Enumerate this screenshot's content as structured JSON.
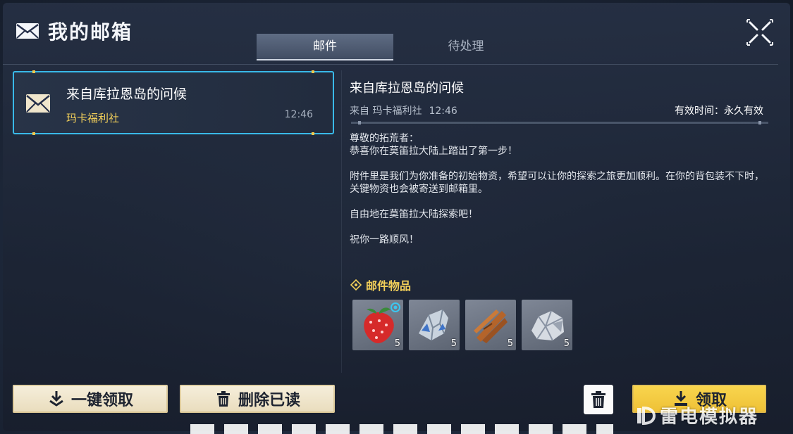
{
  "header": {
    "title": "我的邮箱",
    "icon": "envelope-icon",
    "close_icon": "close-x-icon"
  },
  "tabs": [
    {
      "label": "邮件",
      "active": true
    },
    {
      "label": "待处理",
      "active": false
    }
  ],
  "mail_list": [
    {
      "subject": "来自库拉恩岛的问候",
      "sender": "玛卡福利社",
      "time": "12:46",
      "selected": true
    }
  ],
  "detail": {
    "subject": "来自库拉恩岛的问候",
    "from_label": "来自 玛卡福利社",
    "time": "12:46",
    "validity": "有效时间：永久有效",
    "body": [
      "尊敬的拓荒者：",
      "恭喜你在莫笛拉大陆上踏出了第一步！",
      "附件里是我们为你准备的初始物资，希望可以让你的探索之旅更加顺利。在你的背包装不下时，关键物资也会被寄送到邮箱里。",
      "自由地在莫笛拉大陆探索吧！",
      "祝你一路顺风！"
    ],
    "attachments_title": "邮件物品",
    "attachments": [
      {
        "icon": "strawberry-icon",
        "qty": "5"
      },
      {
        "icon": "crystal-ore-icon",
        "qty": "5"
      },
      {
        "icon": "wood-sticks-icon",
        "qty": "5"
      },
      {
        "icon": "stone-ore-icon",
        "qty": "5"
      }
    ]
  },
  "buttons": {
    "claim_all": "一键领取",
    "delete_read": "删除已读",
    "claim": "领取",
    "trash_icon": "trash-icon"
  },
  "watermark": "雷电模拟器",
  "colors": {
    "accent_blue": "#39b9e8",
    "gold": "#f2cf5a",
    "claim_yellow": "#f5cd40"
  }
}
